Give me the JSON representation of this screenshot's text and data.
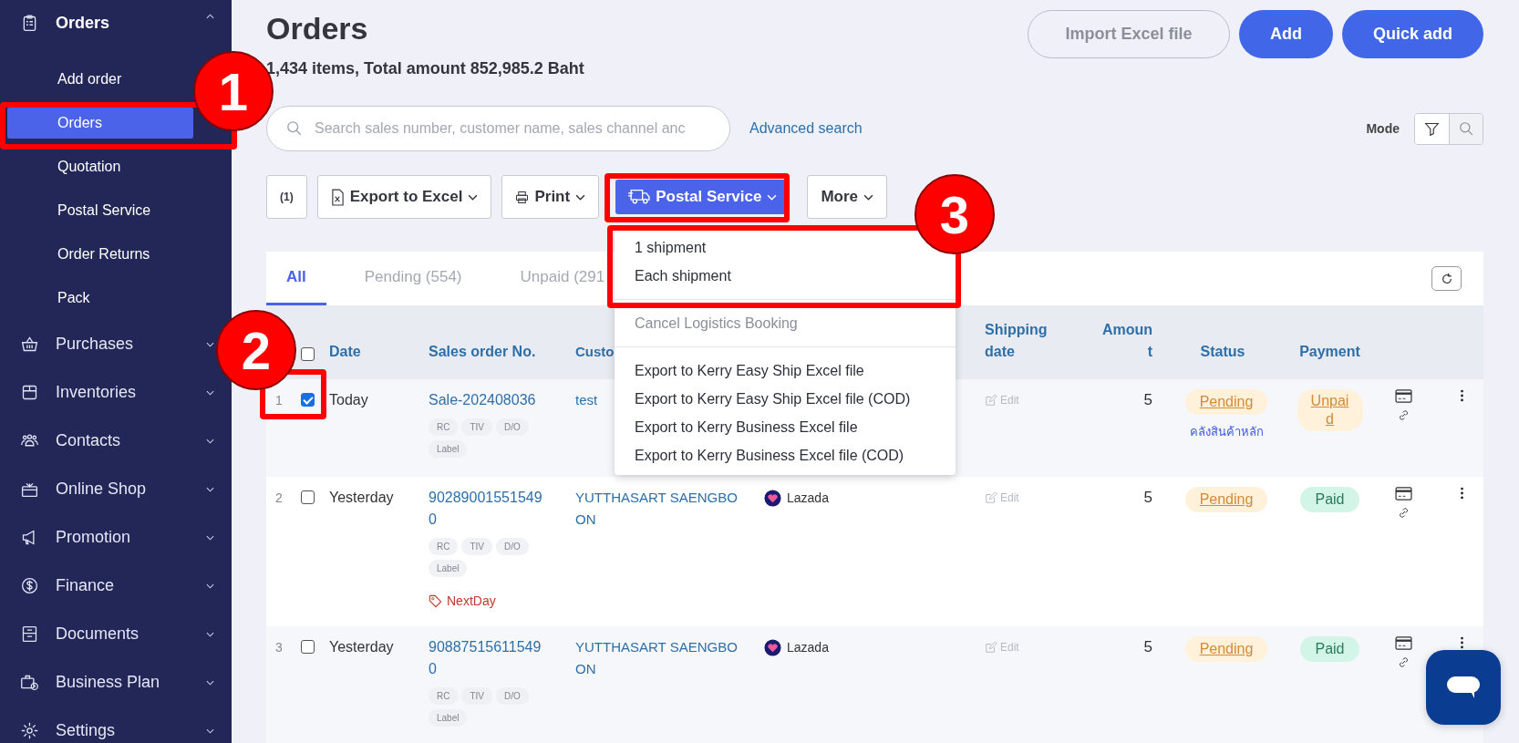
{
  "sidebar": {
    "groups": [
      {
        "label": "Orders",
        "expanded": true,
        "children": [
          {
            "label": "Add order",
            "selected": false
          },
          {
            "label": "Orders",
            "selected": true
          },
          {
            "label": "Quotation",
            "selected": false
          },
          {
            "label": "Postal Service",
            "selected": false
          },
          {
            "label": "Order Returns",
            "selected": false
          },
          {
            "label": "Pack",
            "selected": false
          }
        ]
      },
      {
        "label": "Purchases",
        "expanded": false
      },
      {
        "label": "Inventories",
        "expanded": false
      },
      {
        "label": "Contacts",
        "expanded": false
      },
      {
        "label": "Online Shop",
        "expanded": false
      },
      {
        "label": "Promotion",
        "expanded": false
      },
      {
        "label": "Finance",
        "expanded": false
      },
      {
        "label": "Documents",
        "expanded": false
      },
      {
        "label": "Business Plan",
        "expanded": false
      },
      {
        "label": "Settings",
        "expanded": false
      }
    ]
  },
  "page": {
    "title": "Orders",
    "summary": "1,434 items, Total amount 852,985.2 Baht"
  },
  "header_buttons": [
    {
      "label": "Import Excel file",
      "primary": false
    },
    {
      "label": "Add",
      "primary": true
    },
    {
      "label": "Quick add",
      "primary": true
    }
  ],
  "search": {
    "placeholder": "Search sales number, customer name, sales channel anc"
  },
  "advanced_search": "Advanced search",
  "mode": {
    "label": "Mode",
    "options": [
      {
        "kind": "filter",
        "selected": true
      },
      {
        "kind": "search",
        "selected": false
      }
    ]
  },
  "toolbar": [
    {
      "label": "(1)",
      "kind": "plain",
      "caret": false,
      "active": false
    },
    {
      "label": "Export to Excel",
      "kind": "excel",
      "caret": true,
      "active": false
    },
    {
      "label": "Print",
      "kind": "print",
      "caret": true,
      "active": false
    },
    {
      "label": "Postal Service",
      "kind": "truck",
      "caret": true,
      "active": true
    },
    {
      "label": "More",
      "kind": "plain",
      "caret": true,
      "active": false
    }
  ],
  "postal_menu": {
    "groups": [
      [
        {
          "label": "1 shipment",
          "disabled": false
        },
        {
          "label": "Each shipment",
          "disabled": false
        }
      ],
      [
        {
          "label": "Cancel Logistics Booking",
          "disabled": true
        }
      ],
      [
        {
          "label": "Export to Kerry Easy Ship Excel file",
          "disabled": false
        },
        {
          "label": "Export to Kerry Easy Ship Excel file (COD)",
          "disabled": false
        },
        {
          "label": "Export to Kerry Business Excel file",
          "disabled": false
        },
        {
          "label": "Export to Kerry Business Excel file (COD)",
          "disabled": false
        }
      ]
    ]
  },
  "tabs": [
    {
      "label": "All",
      "selected": true
    },
    {
      "label": "Pending (554)",
      "selected": false
    },
    {
      "label": "Unpaid (291",
      "selected": false
    }
  ],
  "table": {
    "header_checked": false,
    "columns": [
      "Date",
      "Sales order No.",
      "Custo",
      "Shipping date",
      "Amount",
      "Status",
      "Payment"
    ],
    "rows": [
      {
        "index": "1",
        "checked": true,
        "date": "Today",
        "order_no": "Sale-202408036",
        "doc_tags": [
          "RC",
          "TIV",
          "D/O",
          "Label"
        ],
        "tags": [],
        "customer": "test",
        "shipping": "Edit",
        "amount": "5",
        "status": "Pending",
        "warehouse": "คลังสินค้าหลัก",
        "payment": "Unpaid",
        "paid": false
      },
      {
        "index": "2",
        "checked": false,
        "date": "Yesterday",
        "order_no": "902890015515490",
        "doc_tags": [
          "RC",
          "TIV",
          "D/O",
          "Label"
        ],
        "tags": [
          "NextDay"
        ],
        "customer": "YUTTHASART SAENGBOON",
        "channel": "Lazada",
        "shipping": "Edit",
        "amount": "5",
        "status": "Pending",
        "payment": "Paid",
        "paid": true
      },
      {
        "index": "3",
        "checked": false,
        "date": "Yesterday",
        "order_no": "908875156115490",
        "doc_tags": [
          "RC",
          "TIV",
          "D/O",
          "Label"
        ],
        "tags": [],
        "customer": "YUTTHASART SAENGBOON",
        "channel": "Lazada",
        "shipping": "Edit",
        "amount": "5",
        "status": "Pending",
        "payment": "Paid",
        "paid": true
      }
    ]
  },
  "annotations": [
    {
      "number": "1"
    },
    {
      "number": "2"
    },
    {
      "number": "3"
    }
  ]
}
